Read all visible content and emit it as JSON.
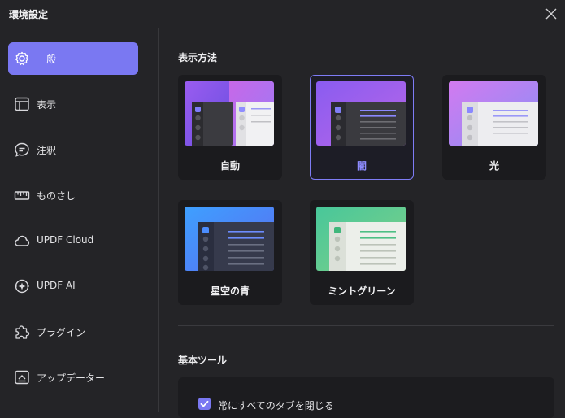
{
  "window": {
    "title": "環境設定"
  },
  "sidebar": {
    "items": [
      {
        "label": "一般",
        "icon": "gear-icon",
        "active": true
      },
      {
        "label": "表示",
        "icon": "layout-icon",
        "active": false
      },
      {
        "label": "注釈",
        "icon": "comment-icon",
        "active": false
      },
      {
        "label": "ものさし",
        "icon": "ruler-icon",
        "active": false
      },
      {
        "label": "UPDF Cloud",
        "icon": "cloud-icon",
        "active": false
      },
      {
        "label": "UPDF AI",
        "icon": "ai-icon",
        "active": false
      },
      {
        "label": "プラグイン",
        "icon": "puzzle-icon",
        "active": false
      },
      {
        "label": "アップデーター",
        "icon": "update-icon",
        "active": false
      }
    ]
  },
  "display": {
    "title": "表示方法",
    "themes": [
      {
        "label": "自動",
        "selected": false
      },
      {
        "label": "闇",
        "selected": true
      },
      {
        "label": "光",
        "selected": false
      },
      {
        "label": "星空の青",
        "selected": false
      },
      {
        "label": "ミントグリーン",
        "selected": false
      }
    ]
  },
  "tools": {
    "title": "基本ツール",
    "close_all_tabs": {
      "label": "常にすべてのタブを閉じる",
      "checked": true
    }
  },
  "colors": {
    "accent": "#7a78f2",
    "background": "#242427",
    "card": "#1b1b1e"
  }
}
